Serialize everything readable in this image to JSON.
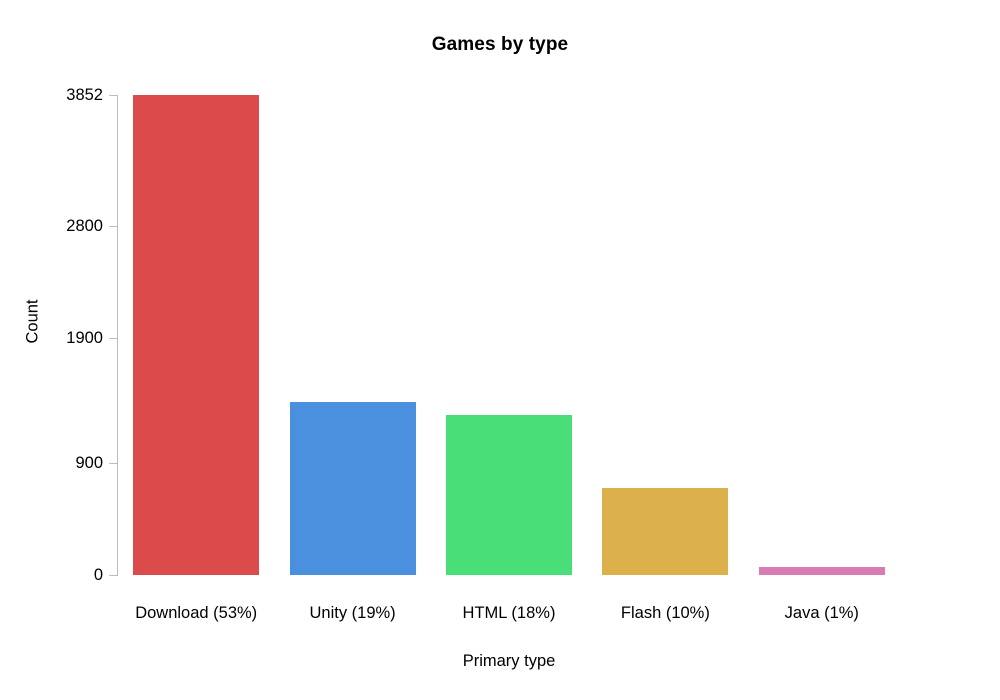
{
  "chart_data": {
    "type": "bar",
    "title": "Games by type",
    "xlabel": "Primary type",
    "ylabel": "Count",
    "categories": [
      "Download (53%)",
      "Unity (19%)",
      "HTML (18%)",
      "Flash (10%)",
      "Java (1%)"
    ],
    "values": [
      3852,
      1388,
      1284,
      700,
      64
    ],
    "colors": [
      "#dc4b4b",
      "#4a90de",
      "#4ade78",
      "#dcb04a",
      "#d97cb4"
    ],
    "ylim": [
      0,
      3852
    ],
    "yticks": [
      0,
      900,
      1900,
      2800,
      3852
    ],
    "ytick_labels": [
      "0",
      "900",
      "1900",
      "2800",
      "3852"
    ],
    "grid": false,
    "legend": "none",
    "axis_color": "#bdbdbd",
    "background": "#ffffff"
  }
}
